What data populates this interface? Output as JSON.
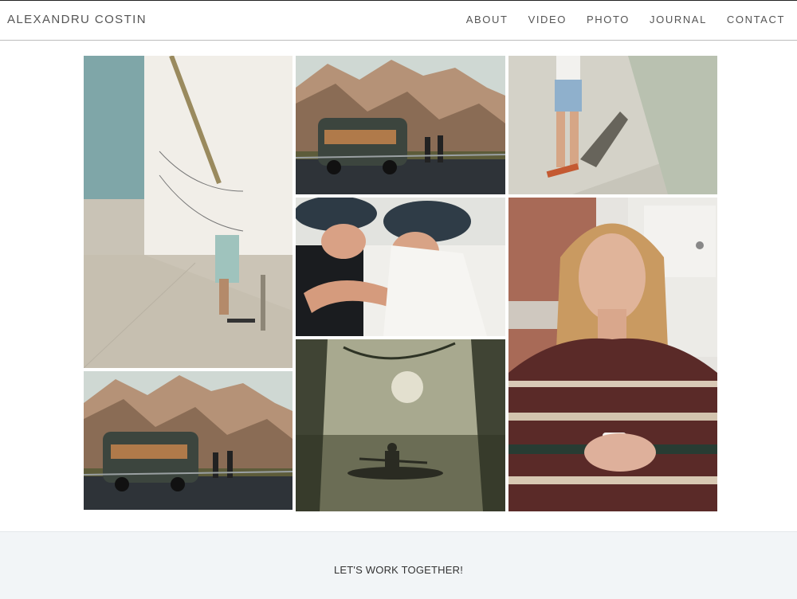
{
  "header": {
    "brand": "ALEXANDRU COSTIN",
    "nav": [
      {
        "label": "ABOUT"
      },
      {
        "label": "VIDEO"
      },
      {
        "label": "PHOTO"
      },
      {
        "label": "JOURNAL"
      },
      {
        "label": "CONTACT"
      }
    ]
  },
  "gallery": {
    "photos": [
      {
        "icon": "skater-wall-photo"
      },
      {
        "icon": "van-mountains-photo"
      },
      {
        "icon": "skateboard-legs-photo"
      },
      {
        "icon": "couple-hats-photo"
      },
      {
        "icon": "portrait-woman-photo"
      },
      {
        "icon": "van-mountains-photo"
      },
      {
        "icon": "kayak-lake-photo"
      }
    ]
  },
  "footer": {
    "cta": "LET'S WORK TOGETHER!"
  },
  "colors": {
    "text": "#555555",
    "footer_bg": "#f2f5f7",
    "header_border": "#bdbdbd"
  }
}
